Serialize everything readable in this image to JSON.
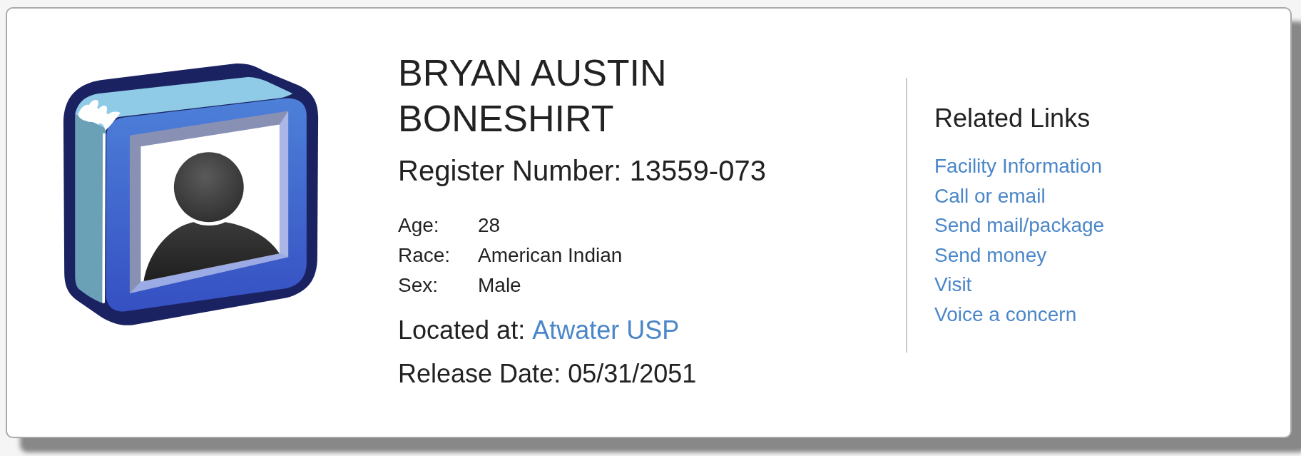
{
  "inmate": {
    "name": "BRYAN AUSTIN BONESHIRT",
    "register": {
      "label": "Register Number:",
      "value": "13559-073"
    },
    "details": [
      {
        "label": "Age:",
        "value": "28"
      },
      {
        "label": "Race:",
        "value": "American Indian"
      },
      {
        "label": "Sex:",
        "value": "Male"
      }
    ],
    "location": {
      "label": "Located at:",
      "link": "Atwater USP"
    },
    "release": {
      "label": "Release Date:",
      "value": "05/31/2051"
    }
  },
  "related_links": {
    "title": "Related Links",
    "links": [
      "Facility Information",
      "Call or email",
      "Send mail/package",
      "Send money",
      "Visit",
      "Voice a concern"
    ]
  }
}
